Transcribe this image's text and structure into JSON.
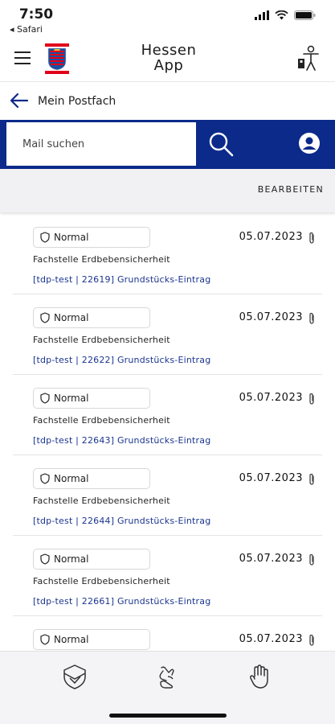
{
  "status_bar": {
    "time": "7:50",
    "back_app": "◂ Safari",
    "icons": [
      "signal-icon",
      "wifi-icon",
      "battery-icon"
    ]
  },
  "header": {
    "title_line1": "Hessen",
    "title_line2": "App",
    "crest_icon": "hessen-crest-icon",
    "menu_icon": "menu-icon",
    "accessibility_icon": "accessibility-icon"
  },
  "sub_header": {
    "title": "Mein Postfach",
    "back_icon": "back-arrow-icon"
  },
  "search": {
    "placeholder": "Mail suchen",
    "value": ""
  },
  "toolbar": {
    "edit_label": "BEARBEITEN"
  },
  "messages": [
    {
      "priority": "Normal",
      "date": "05.07.2023",
      "sender": "Fachstelle Erdbebensicherheit",
      "subject": "[tdp-test | 22619] Grundstücks-Eintrag"
    },
    {
      "priority": "Normal",
      "date": "05.07.2023",
      "sender": "Fachstelle Erdbebensicherheit",
      "subject": "[tdp-test | 22622] Grundstücks-Eintrag"
    },
    {
      "priority": "Normal",
      "date": "05.07.2023",
      "sender": "Fachstelle Erdbebensicherheit",
      "subject": "[tdp-test | 22643] Grundstücks-Eintrag"
    },
    {
      "priority": "Normal",
      "date": "05.07.2023",
      "sender": "Fachstelle Erdbebensicherheit",
      "subject": "[tdp-test | 22644] Grundstücks-Eintrag"
    },
    {
      "priority": "Normal",
      "date": "05.07.2023",
      "sender": "Fachstelle Erdbebensicherheit",
      "subject": "[tdp-test | 22661] Grundstücks-Eintrag"
    },
    {
      "priority": "Normal",
      "date": "05.07.2023",
      "sender": "",
      "subject": ""
    }
  ],
  "bottom_nav": {
    "items": [
      "shield-check-icon",
      "sign-language-icon",
      "hand-icon"
    ]
  },
  "colors": {
    "brand_blue": "#0b2a8a",
    "link_blue": "#1b3590",
    "toolbar_gray": "#f1f1f3"
  }
}
